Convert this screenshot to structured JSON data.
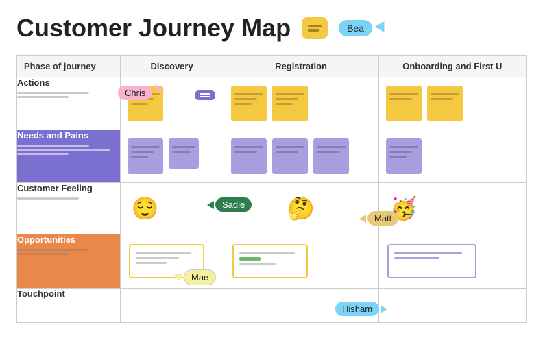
{
  "header": {
    "title": "Customer Journey Map",
    "chat_icon_label": "chat-icon",
    "bea_label": "Bea"
  },
  "table": {
    "col_headers": [
      "Phase of journey",
      "Discovery",
      "Registration",
      "Onboarding and First U"
    ],
    "rows": [
      {
        "label": "Actions",
        "label_style": "normal",
        "stickies_discovery": [
          {
            "color": "yellow"
          }
        ],
        "stickies_registration": [
          {
            "color": "yellow"
          },
          {
            "color": "yellow"
          }
        ],
        "stickies_onboarding": [
          {
            "color": "yellow"
          },
          {
            "color": "yellow"
          }
        ]
      },
      {
        "label": "Needs and Pains",
        "label_style": "purple",
        "stickies_discovery": [
          {
            "color": "purple"
          },
          {
            "color": "purple"
          }
        ],
        "stickies_registration": [
          {
            "color": "purple"
          },
          {
            "color": "purple"
          },
          {
            "color": "purple"
          }
        ],
        "stickies_onboarding": [
          {
            "color": "purple"
          }
        ]
      },
      {
        "label": "Customer Feeling",
        "label_style": "normal",
        "emoji_discovery": "😌",
        "emoji_registration": "🤔",
        "emoji_onboarding": "🥳"
      },
      {
        "label": "Opportunities",
        "label_style": "orange",
        "opp_discovery": true,
        "opp_registration": true,
        "opp_onboarding": true
      },
      {
        "label": "Touchpoint",
        "label_style": "normal"
      }
    ]
  },
  "annotations": {
    "chris": "Chris",
    "sadie": "Sadie",
    "matt": "Matt",
    "mae": "Mae",
    "hisham": "Hisham"
  }
}
